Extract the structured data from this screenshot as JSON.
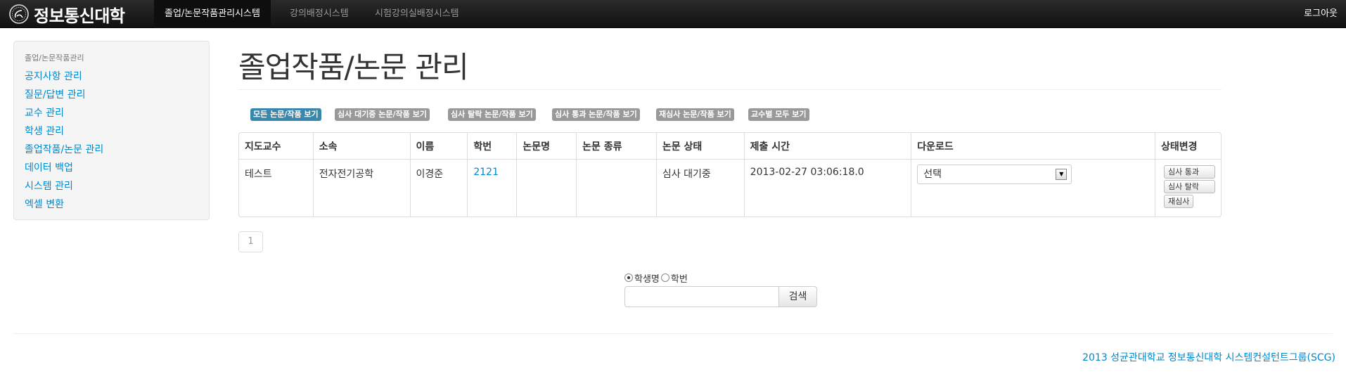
{
  "navbar": {
    "brand": "정보통신대학",
    "items": [
      "졸업/논문작품관리시스템",
      "강의배정시스템",
      "시험강의실배정시스템"
    ],
    "logout": "로그아웃"
  },
  "sidebar": {
    "header": "졸업/논문작품관리",
    "items": [
      "공지사항 관리",
      "질문/답변 관리",
      "교수 관리",
      "학생 관리",
      "졸업작품/논문 관리",
      "데이터 백업",
      "시스템 관리",
      "엑셀 변환"
    ]
  },
  "page": {
    "title": "졸업작품/논문 관리"
  },
  "filters": [
    "모든 논문/작품 보기",
    "심사 대기중 논문/작품 보기",
    "심사 탈락 논문/작품 보기",
    "심사 통과 논문/작품 보기",
    "재심사 논문/작품 보기",
    "교수별 모두 보기"
  ],
  "table": {
    "headers": [
      "지도교수",
      "소속",
      "이름",
      "학번",
      "논문명",
      "논문 종류",
      "논문 상태",
      "제출 시간",
      "다운로드",
      "상태변경"
    ],
    "rows": [
      {
        "advisor": "테스트",
        "department": "전자전기공학",
        "name": "이경준",
        "student_id": "2121",
        "paper_title": "",
        "paper_type": "",
        "status": "심사 대기중",
        "submitted": "2013-02-27 03:06:18.0",
        "download_select": "선택",
        "actions": [
          "심사 통과",
          "심사 탈락",
          "재심사"
        ]
      }
    ]
  },
  "pagination": {
    "current": "1"
  },
  "search": {
    "options": [
      "학생명",
      "학번"
    ],
    "selected": "학생명",
    "value": "",
    "button": "검색"
  },
  "footer": {
    "text": "2013 성균관대학교 정보통신대학 시스템컨설턴트그룹(SCG)"
  },
  "colors": {
    "navbar": "#1b1b1b",
    "link": "#0088cc",
    "active_label": "#3a87ad",
    "label": "#999999"
  }
}
